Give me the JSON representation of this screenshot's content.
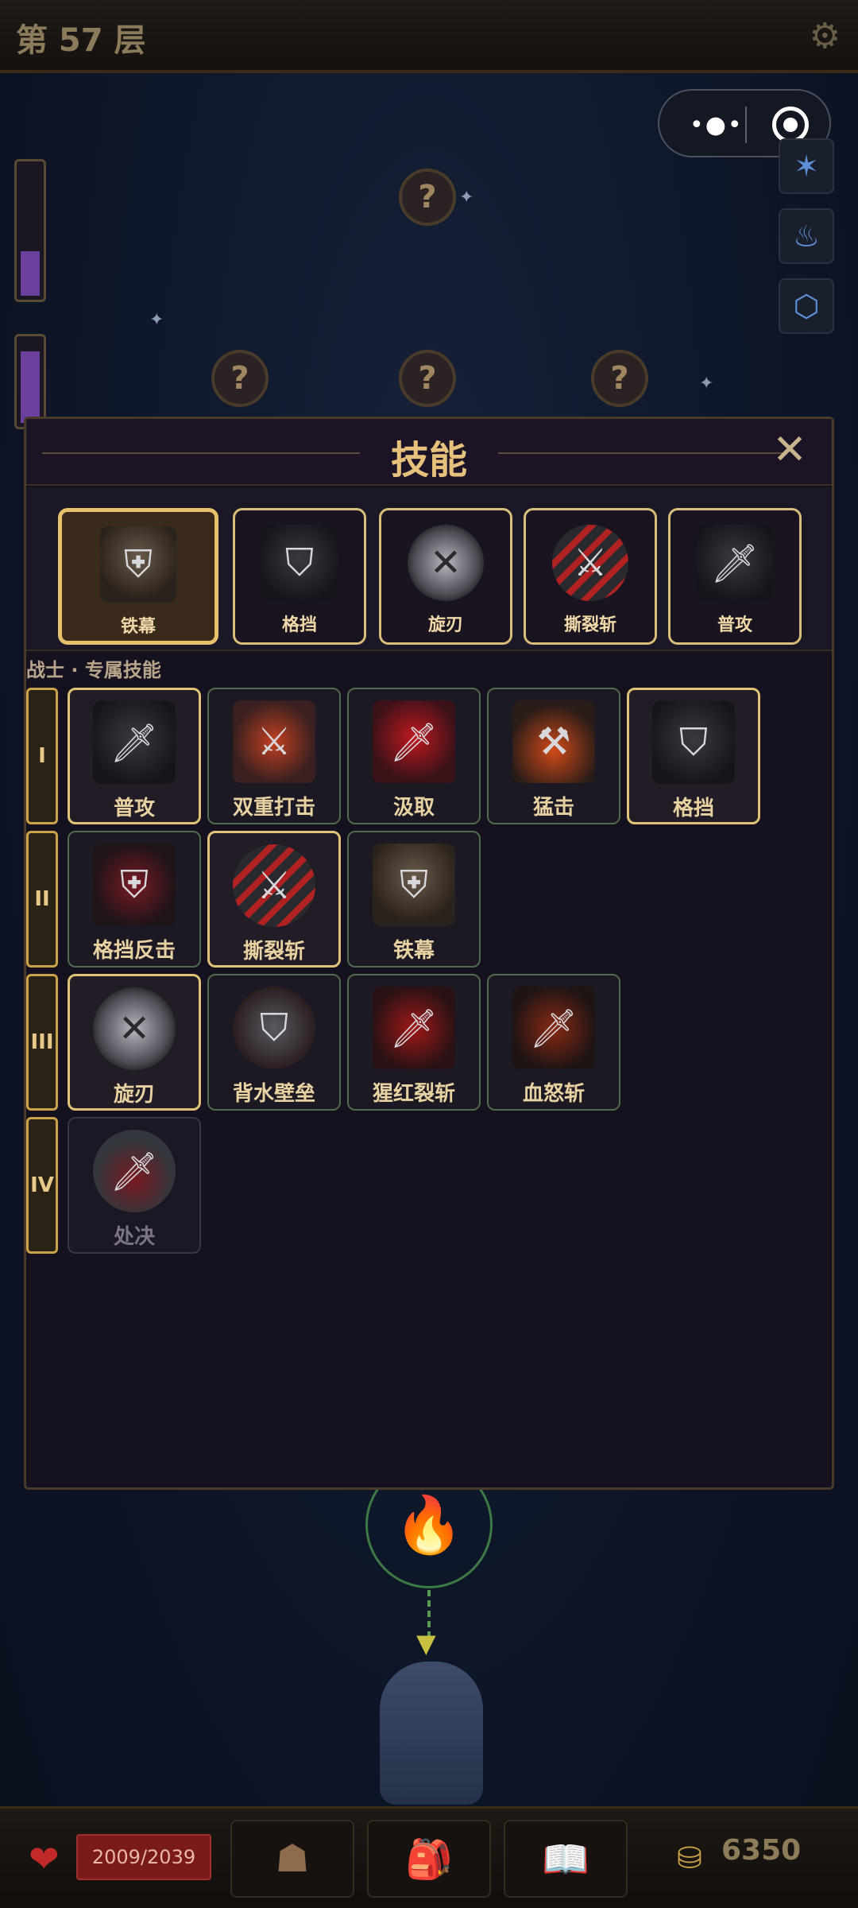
{
  "header": {
    "floor": "第 57 层"
  },
  "map": {
    "node_mark": "?",
    "campfire_icon": "campfire-icon"
  },
  "panel": {
    "title": "技能",
    "close_icon": "close-icon",
    "equipped": [
      {
        "label": "铁幕",
        "icon": "iron-curtain-icon",
        "selected": true
      },
      {
        "label": "格挡",
        "icon": "block-icon"
      },
      {
        "label": "旋刃",
        "icon": "spin-blade-icon"
      },
      {
        "label": "撕裂斩",
        "icon": "rending-slash-icon"
      },
      {
        "label": "普攻",
        "icon": "basic-attack-icon"
      }
    ],
    "section_label": "战士 · 专属技能",
    "tiers": [
      {
        "tier": "I",
        "skills": [
          {
            "label": "普攻",
            "state": "owned"
          },
          {
            "label": "双重打击",
            "state": "available"
          },
          {
            "label": "汲取",
            "state": "available"
          },
          {
            "label": "猛击",
            "state": "available"
          },
          {
            "label": "格挡",
            "state": "owned"
          }
        ]
      },
      {
        "tier": "II",
        "skills": [
          {
            "label": "格挡反击",
            "state": "available"
          },
          {
            "label": "撕裂斩",
            "state": "owned"
          },
          {
            "label": "铁幕",
            "state": "available"
          }
        ]
      },
      {
        "tier": "III",
        "skills": [
          {
            "label": "旋刃",
            "state": "owned"
          },
          {
            "label": "背水壁垒",
            "state": "available"
          },
          {
            "label": "猩红裂斩",
            "state": "available"
          },
          {
            "label": "血怒斩",
            "state": "available"
          }
        ]
      },
      {
        "tier": "IV",
        "skills": [
          {
            "label": "处决",
            "state": "locked"
          }
        ]
      }
    ]
  },
  "bottom": {
    "hp": "2009/2039",
    "coins": "6350"
  },
  "colors": {
    "accent_gold": "#e6c06a",
    "available_border": "#4f6b4e",
    "hp_red": "#7a1a1a"
  }
}
